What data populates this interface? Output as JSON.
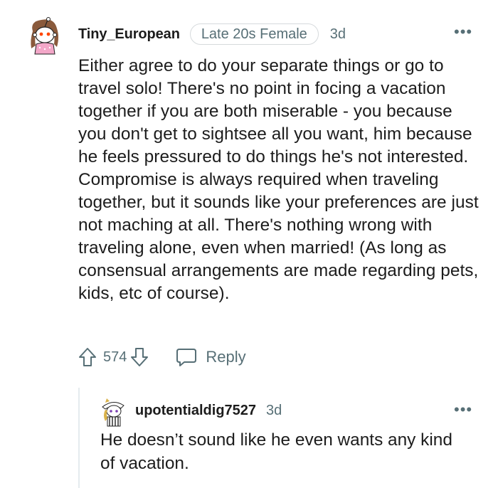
{
  "comment": {
    "username": "Tiny_European",
    "flair": "Late 20s Female",
    "age": "3d",
    "more_label": "•••",
    "body": "Either agree to do your separate things or go to travel solo! There's no point in focing a vacation together if you are both miserable - you because you don't get to sightsee all you want, him because he feels pressured to do things he's not interested. Compromise is always required when traveling together, but it sounds like your preferences are just not maching at all. There's nothing wrong with traveling alone, even when married! (As long as consensual arrangements are made regarding pets, kids, etc of course).",
    "score": "574",
    "reply_label": "Reply",
    "icons": {
      "upvote": "upvote-arrow-icon",
      "downvote": "downvote-arrow-icon",
      "reply": "speech-bubble-icon",
      "avatar": "snoo-avatar"
    }
  },
  "reply": {
    "username": "upotentialdig7527",
    "age": "3d",
    "more_label": "•••",
    "body": "He doesn’t sound like he even wants any kind of vacation."
  },
  "colors": {
    "text": "#1c1c1c",
    "meta": "#576f76",
    "border": "#d6dadc",
    "thread_line": "#e5ebee",
    "avatar_accent": "#ff4500"
  }
}
